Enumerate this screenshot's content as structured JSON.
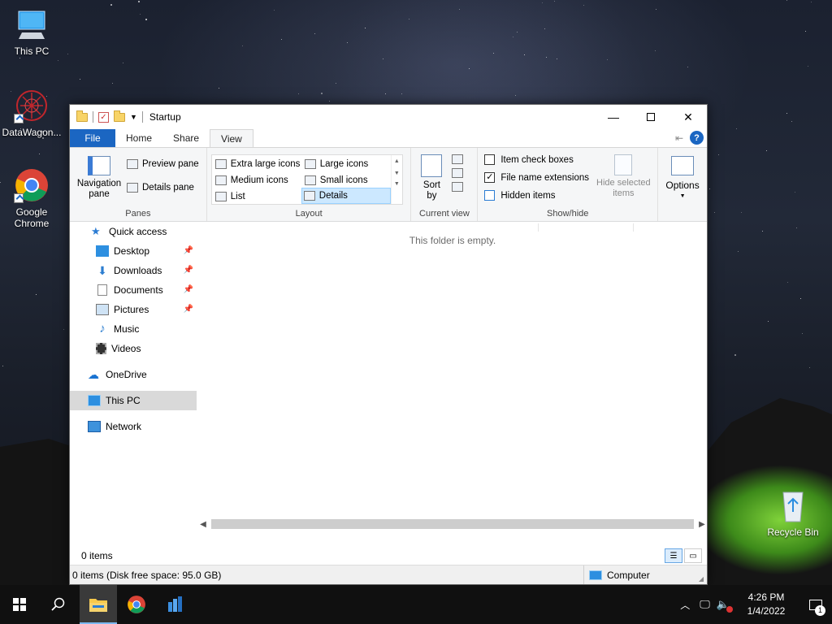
{
  "desktop": {
    "icons": [
      {
        "label": "This PC"
      },
      {
        "label": "DataWagon..."
      },
      {
        "label": "Google Chrome"
      },
      {
        "label": "Recycle Bin"
      }
    ]
  },
  "window": {
    "title": "Startup",
    "tabs": {
      "file": "File",
      "home": "Home",
      "share": "Share",
      "view": "View"
    },
    "ribbon": {
      "panes": {
        "navigation_pane": "Navigation pane",
        "preview_pane": "Preview pane",
        "details_pane": "Details pane",
        "group_label": "Panes"
      },
      "layout": {
        "items": [
          "Extra large icons",
          "Large icons",
          "Medium icons",
          "Small icons",
          "List",
          "Details"
        ],
        "selected": "Details",
        "group_label": "Layout"
      },
      "current_view": {
        "sort_by": "Sort by",
        "group_label": "Current view"
      },
      "show_hide": {
        "item_check_boxes": "Item check boxes",
        "item_check_boxes_checked": false,
        "file_name_extensions": "File name extensions",
        "file_name_extensions_checked": true,
        "hidden_items": "Hidden items",
        "hidden_items_checked": false,
        "hide_selected_items": "Hide selected items",
        "group_label": "Show/hide"
      },
      "options": "Options"
    },
    "nav": {
      "quick_access": "Quick access",
      "items": [
        {
          "label": "Desktop",
          "pinned": true
        },
        {
          "label": "Downloads",
          "pinned": true
        },
        {
          "label": "Documents",
          "pinned": true
        },
        {
          "label": "Pictures",
          "pinned": true
        },
        {
          "label": "Music",
          "pinned": false
        },
        {
          "label": "Videos",
          "pinned": false
        }
      ],
      "onedrive": "OneDrive",
      "this_pc": "This PC",
      "network": "Network",
      "selected": "This PC"
    },
    "main": {
      "empty_message": "This folder is empty."
    },
    "status": {
      "item_count": "0 items",
      "detail": "0 items (Disk free space: 95.0 GB)",
      "location": "Computer"
    }
  },
  "taskbar": {
    "clock_time": "4:26 PM",
    "clock_date": "1/4/2022",
    "notification_count": "1"
  }
}
